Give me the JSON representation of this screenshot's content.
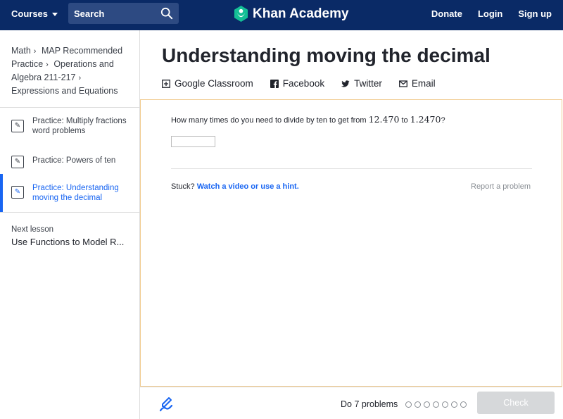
{
  "header": {
    "courses_label": "Courses",
    "search_placeholder": "Search",
    "logo_text": "Khan Academy",
    "donate": "Donate",
    "login": "Login",
    "signup": "Sign up",
    "bg_color": "#0a2a66"
  },
  "sidebar": {
    "breadcrumbs": [
      "Math",
      "MAP Recommended Practice",
      "Operations and Algebra 211-217",
      "Expressions and Equations"
    ],
    "lessons": [
      {
        "label": "Practice: Multiply fractions word problems",
        "active": false
      },
      {
        "label": "Practice: Powers of ten",
        "active": false
      },
      {
        "label": "Practice: Understanding moving the decimal",
        "active": true
      }
    ],
    "next_lesson_label": "Next lesson",
    "next_lesson_title": "Use Functions to Model R..."
  },
  "main": {
    "title": "Understanding moving the decimal",
    "share": {
      "google": "Google Classroom",
      "facebook": "Facebook",
      "twitter": "Twitter",
      "email": "Email"
    },
    "question_text": "How many times do you need to divide by ten to get from",
    "question_from": "12.470",
    "question_to_word": "to",
    "question_to": "1.2470",
    "question_end": "?",
    "stuck_label": "Stuck?",
    "stuck_link": "Watch a video or use a hint.",
    "report": "Report a problem"
  },
  "footer": {
    "do_problems": "Do 7 problems",
    "problem_count": 7,
    "check_label": "Check",
    "accent": "#1865f2"
  }
}
